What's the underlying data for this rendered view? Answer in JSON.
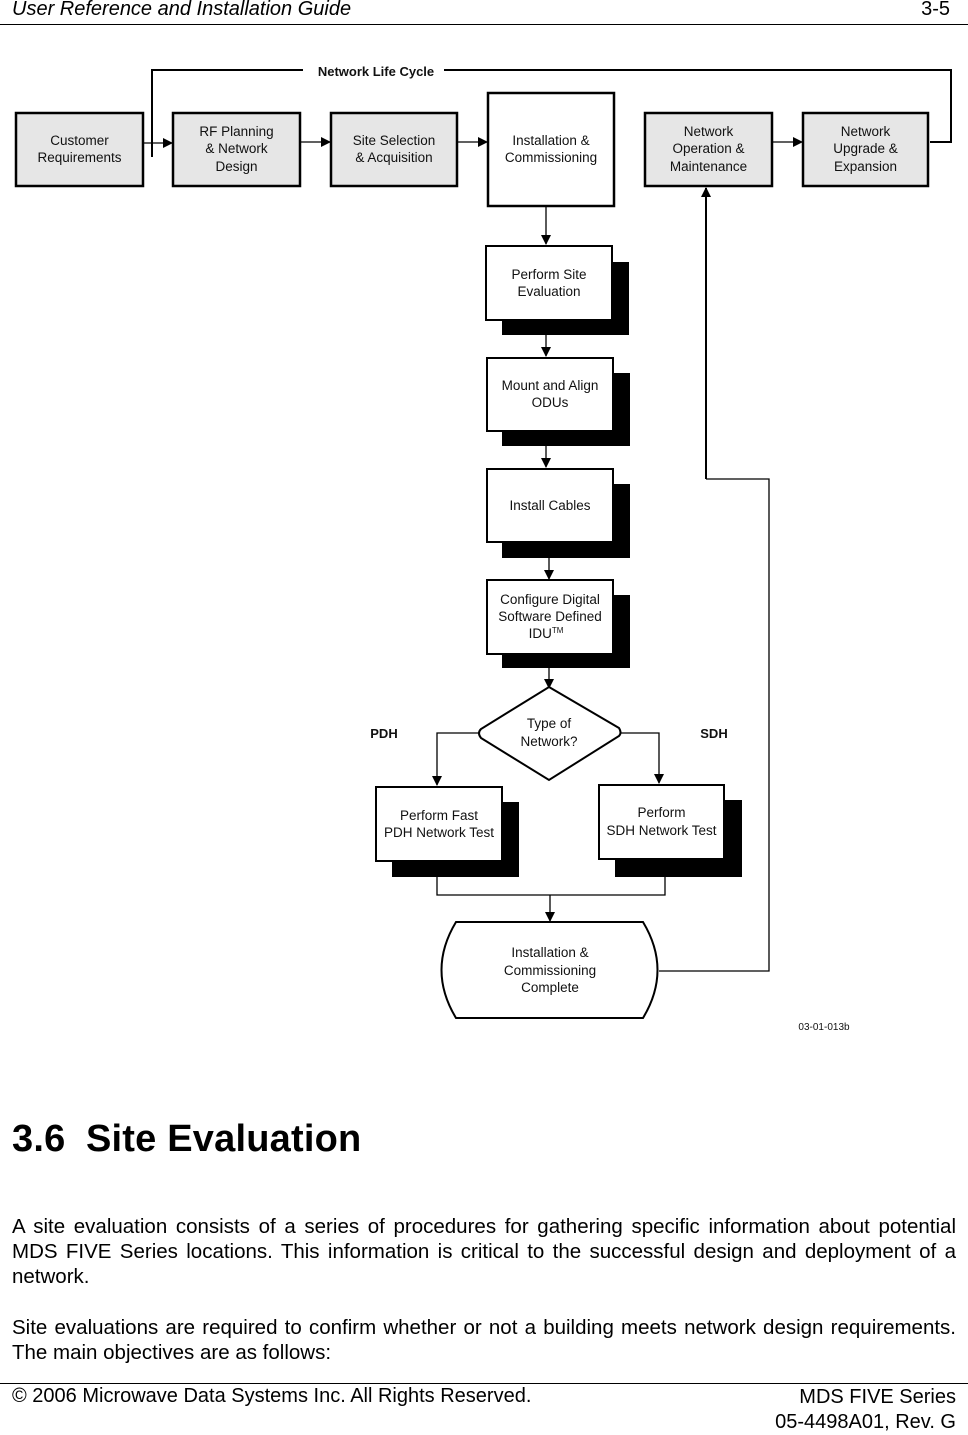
{
  "header": {
    "title": "User Reference and Installation Guide",
    "page_number": "3-5"
  },
  "diagram": {
    "loop_label": "Network Life Cycle",
    "top_row": [
      {
        "id": "customer",
        "lines": [
          "Customer",
          "Requirements"
        ]
      },
      {
        "id": "rf-planning",
        "lines": [
          "RF Planning",
          "& Network",
          "Design"
        ]
      },
      {
        "id": "site-selection",
        "lines": [
          "Site Selection",
          "& Acquisition"
        ]
      },
      {
        "id": "installation",
        "lines": [
          "Installation &",
          "Commissioning"
        ]
      },
      {
        "id": "operation",
        "lines": [
          "Network",
          "Operation &",
          "Maintenance"
        ]
      },
      {
        "id": "upgrade",
        "lines": [
          "Network",
          "Upgrade &",
          "Expansion"
        ]
      }
    ],
    "steps": [
      {
        "id": "site-evaluation",
        "lines": [
          "Perform Site",
          "Evaluation"
        ]
      },
      {
        "id": "mount-align",
        "lines": [
          "Mount and Align",
          "ODUs"
        ]
      },
      {
        "id": "install-cables",
        "lines": [
          "Install Cables"
        ]
      },
      {
        "id": "configure-idu",
        "lines": [
          "Configure Digital",
          "Software Defined",
          "IDU"
        ],
        "superscript": "TM"
      }
    ],
    "decision": {
      "lines": [
        "Type of",
        "Network?"
      ]
    },
    "branch_labels": {
      "left": "PDH",
      "right": "SDH"
    },
    "branches": [
      {
        "id": "pdh-test",
        "lines": [
          "Perform Fast",
          "PDH Network Test"
        ]
      },
      {
        "id": "sdh-test",
        "lines": [
          "Perform",
          "SDH Network Test"
        ]
      }
    ],
    "terminal": {
      "lines": [
        "Installation &",
        "Commissioning",
        "Complete"
      ]
    },
    "figure_id": "03-01-013b",
    "colors": {
      "box_fill_gray": "#e6e6e6",
      "box_fill_white": "#ffffff",
      "stroke": "#000000"
    }
  },
  "section": {
    "number": "3.6",
    "title": "Site Evaluation"
  },
  "paragraphs": [
    "A site evaluation consists of a series of procedures for gathering specific information about potential MDS FIVE Series locations.  This information is critical to the successful design and deployment of a network.",
    "Site evaluations are required to confirm whether or not a building meets network design requirements.  The main objectives are as follows:"
  ],
  "footer": {
    "copyright": "© 2006 Microwave Data Systems Inc.  All Rights Reserved.",
    "product": "MDS FIVE Series",
    "doc_number": "05-4498A01, Rev. G"
  }
}
